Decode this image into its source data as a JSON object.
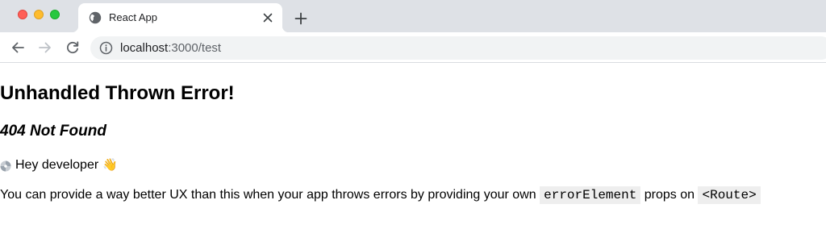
{
  "browser": {
    "tab": {
      "title": "React App",
      "favicon": "globe-icon"
    },
    "new_tab_label": "+",
    "url": {
      "host": "localhost",
      "path": ":3000/test"
    },
    "window_controls": {
      "close_color": "#ff5f57",
      "minimize_color": "#febc2e",
      "zoom_color": "#28c840"
    }
  },
  "page": {
    "title": "Unhandled Thrown Error!",
    "status": "404 Not Found",
    "hey": {
      "icon": "disc-icon",
      "text": "Hey developer",
      "emoji": "👋"
    },
    "description": {
      "before": "You can provide a way better UX than this when your app throws errors by providing your own ",
      "code1": "errorElement",
      "middle": " props on ",
      "code2": "<Route>"
    },
    "code_background": "#eeeeee"
  }
}
